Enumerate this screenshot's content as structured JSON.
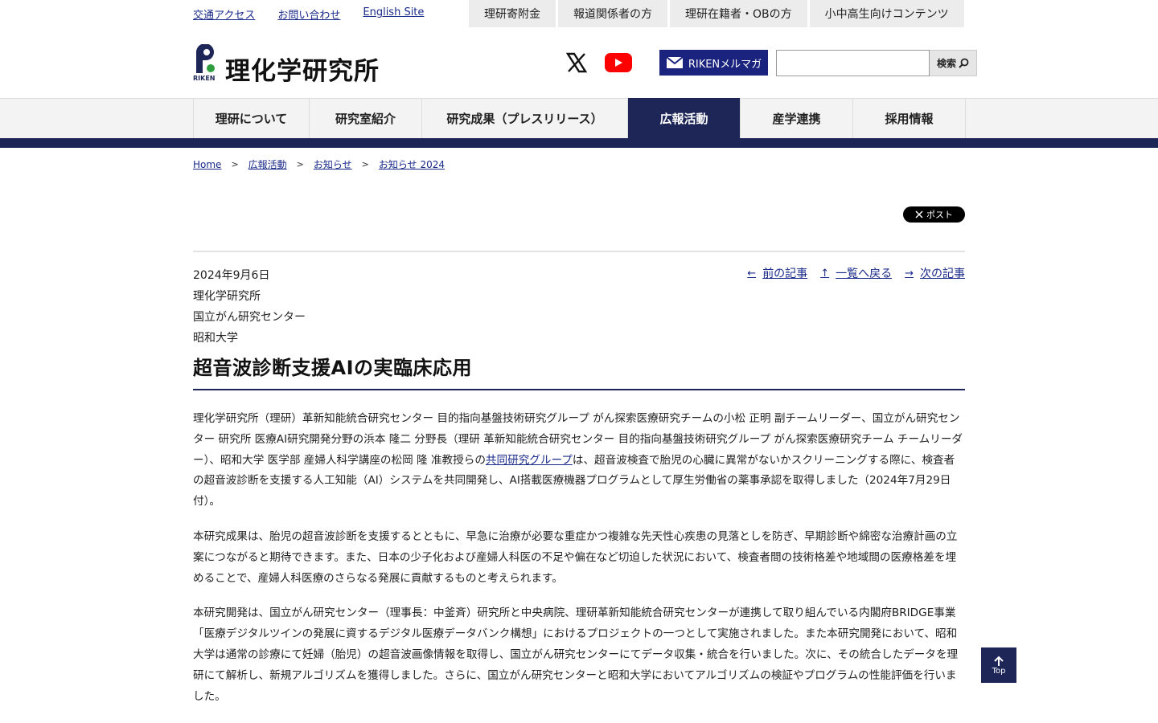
{
  "util": {
    "links": [
      "交通アクセス",
      "お問い合わせ",
      "English Site"
    ],
    "tabs": [
      "理研寄附金",
      "報道関係者の方",
      "理研在籍者・OBの方",
      "小中高生向けコンテンツ"
    ]
  },
  "header": {
    "logo_text": "理化学研究所",
    "logo_sub": "RIKEN",
    "mail_label": "RIKENメルマガ",
    "search_value": "",
    "search_label": "検索"
  },
  "nav": {
    "items": [
      "理研について",
      "研究室紹介",
      "研究成果（プレスリリース）",
      "広報活動",
      "産学連携",
      "採用情報"
    ],
    "active_index": 3
  },
  "breadcrumb": [
    "Home",
    "広報活動",
    "お知らせ",
    "お知らせ 2024"
  ],
  "breadcrumb_sep": ">",
  "share": {
    "post_label": "ポスト"
  },
  "article": {
    "date": "2024年9月6日",
    "orgs": [
      "理化学研究所",
      "国立がん研究センター",
      "昭和大学"
    ],
    "nav": {
      "prev": "前の記事",
      "list": "一覧へ戻る",
      "next": "次の記事"
    },
    "title": "超音波診断支援AIの実臨床応用",
    "p1_before": "理化学研究所（理研）革新知能統合研究センター 目的指向基盤技術研究グループ がん探索医療研究チームの小松 正明 副チームリーダー、国立がん研究センター 研究所 医療AI研究開発分野の浜本 隆二 分野長（理研 革新知能統合研究センター 目的指向基盤技術研究グループ がん探索医療研究チーム チームリーダー）、昭和大学 医学部 産婦人科学講座の松岡 隆 准教授らの",
    "p1_link": "共同研究グループ",
    "p1_after": "は、超音波検査で胎児の心臓に異常がないかスクリーニングする際に、検査者の超音波診断を支援する人工知能（AI）システムを共同開発し、AI搭載医療機器プログラムとして厚生労働省の薬事承認を取得しました（2024年7月29日付）。",
    "p2": "本研究成果は、胎児の超音波診断を支援するとともに、早急に治療が必要な重症かつ複雑な先天性心疾患の見落としを防ぎ、早期診断や綿密な治療計画の立案につながると期待できます。また、日本の少子化および産婦人科医の不足や偏在など切迫した状況において、検査者間の技術格差や地域間の医療格差を埋めることで、産婦人科医療のさらなる発展に貢献するものと考えられます。",
    "p3": "本研究開発は、国立がん研究センター（理事長：中釜斉）研究所と中央病院、理研革新知能統合研究センターが連携して取り組んでいる内閣府BRIDGE事業「医療デジタルツインの発展に資するデジタル医療データバンク構想」におけるプロジェクトの一つとして実施されました。また本研究開発において、昭和大学は通常の診療にて妊婦（胎児）の超音波画像情報を取得し、国立がん研究センターにてデータ収集・統合を行いました。次に、その統合したデータを理研にて解析し、新規アルゴリズムを獲得しました。さらに、国立がん研究センターと昭和大学においてアルゴリズムの検証やプログラムの性能評価を行いました。"
  },
  "top_button": "Top",
  "colors": {
    "navy": "#1d2657",
    "link": "#1a2a8a",
    "youtube": "#ff0000"
  }
}
